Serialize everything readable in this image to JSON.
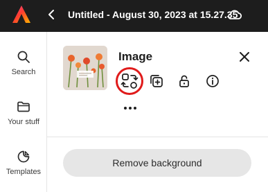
{
  "app": {
    "title": "Untitled - August 30, 2023 at 15.27.35",
    "logo_icon": "adobe-express-logo",
    "back_icon": "chevron-left-icon",
    "cloud_icon": "cloud-icon"
  },
  "sidebar": {
    "items": [
      {
        "label": "Search",
        "icon": "search-icon"
      },
      {
        "label": "Your stuff",
        "icon": "folder-icon"
      },
      {
        "label": "Templates",
        "icon": "templates-icon"
      }
    ]
  },
  "panel": {
    "title": "Image",
    "close_icon": "close-icon",
    "thumbnail_text": "",
    "tools": [
      {
        "name": "replace",
        "icon": "replace-icon",
        "highlighted": true
      },
      {
        "name": "duplicate",
        "icon": "duplicate-icon"
      },
      {
        "name": "lock",
        "icon": "lock-icon"
      },
      {
        "name": "info",
        "icon": "info-icon"
      }
    ],
    "more_icon": "more-icon",
    "remove_background_label": "Remove background"
  },
  "colors": {
    "topbar": "#1d1d1d",
    "highlight": "#e01b1b",
    "button_bg": "#e6e6e6"
  }
}
